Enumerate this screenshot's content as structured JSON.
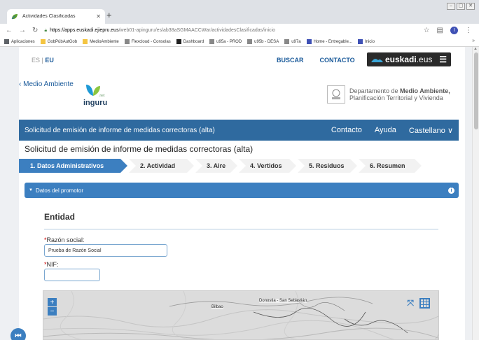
{
  "browser": {
    "tab_title": "Actividades Clasificadas",
    "url_host": "https://apps.euskadi.ejiepru.eus",
    "url_path": "/web01-apinguru/es/ab38aSGMAACCWar/actividadesClasificadas/inicio",
    "bookmarks": [
      {
        "label": "Aplicaciones",
        "color": "#5f6368"
      },
      {
        "label": "GobPúbAutGob",
        "color": "#f4c542"
      },
      {
        "label": "MedioAmbiente",
        "color": "#f4c542"
      },
      {
        "label": "Flexcloud - Consolas",
        "color": "#888888"
      },
      {
        "label": "Dashboard",
        "color": "#222222"
      },
      {
        "label": "u95a - PROD",
        "color": "#888888"
      },
      {
        "label": "u95b - DESA",
        "color": "#888888"
      },
      {
        "label": "u97a",
        "color": "#888888"
      },
      {
        "label": "Home - Entregable...",
        "color": "#3f51b5"
      },
      {
        "label": "Inicio",
        "color": "#3f51b5"
      }
    ],
    "profile_initial": "I"
  },
  "header": {
    "lang_es": "ES",
    "lang_sep": " | ",
    "lang_eu": "EU",
    "nav_search": "BUSCAR",
    "nav_contact": "CONTACTO",
    "brand_bold": "euskadi",
    "brand_thin": ".eus",
    "back_link": "‹ Medio Ambiente",
    "logo_word": "inguru",
    "logo_net": ".net",
    "dept_line1_pre": "Departamento de ",
    "dept_line1_bold": "Medio Ambiente,",
    "dept_line2": "Planificación Territorial y Vivienda"
  },
  "bluebar": {
    "title": "Solicitud de emisión de informe de medidas correctoras (alta)",
    "contact": "Contacto",
    "help": "Ayuda",
    "language": "Castellano ∨"
  },
  "page_title": "Solicitud de emisión de informe de medidas correctoras (alta)",
  "steps": [
    {
      "label": "1. Datos Administrativos",
      "active": true
    },
    {
      "label": "2. Actividad",
      "active": false
    },
    {
      "label": "3. Aire",
      "active": false
    },
    {
      "label": "4. Vertidos",
      "active": false
    },
    {
      "label": "5. Residuos",
      "active": false
    },
    {
      "label": "6. Resumen",
      "active": false
    }
  ],
  "accordion": {
    "title": "Datos del promotor"
  },
  "form": {
    "section_title": "Entidad",
    "razon_label": "Razón social:",
    "razon_value": "Prueba de Razón Social",
    "nif_label": "NIF:",
    "nif_value": "",
    "required_mark": "*"
  },
  "map": {
    "zoom_in": "+",
    "zoom_out": "−",
    "label_bilbao": "Bilbao",
    "label_donostia": "Donostia - San Sebastián"
  },
  "colors": {
    "primary_blue": "#2f6a9f",
    "accent_blue": "#3c7fc0",
    "required_red": "#cc0000"
  }
}
